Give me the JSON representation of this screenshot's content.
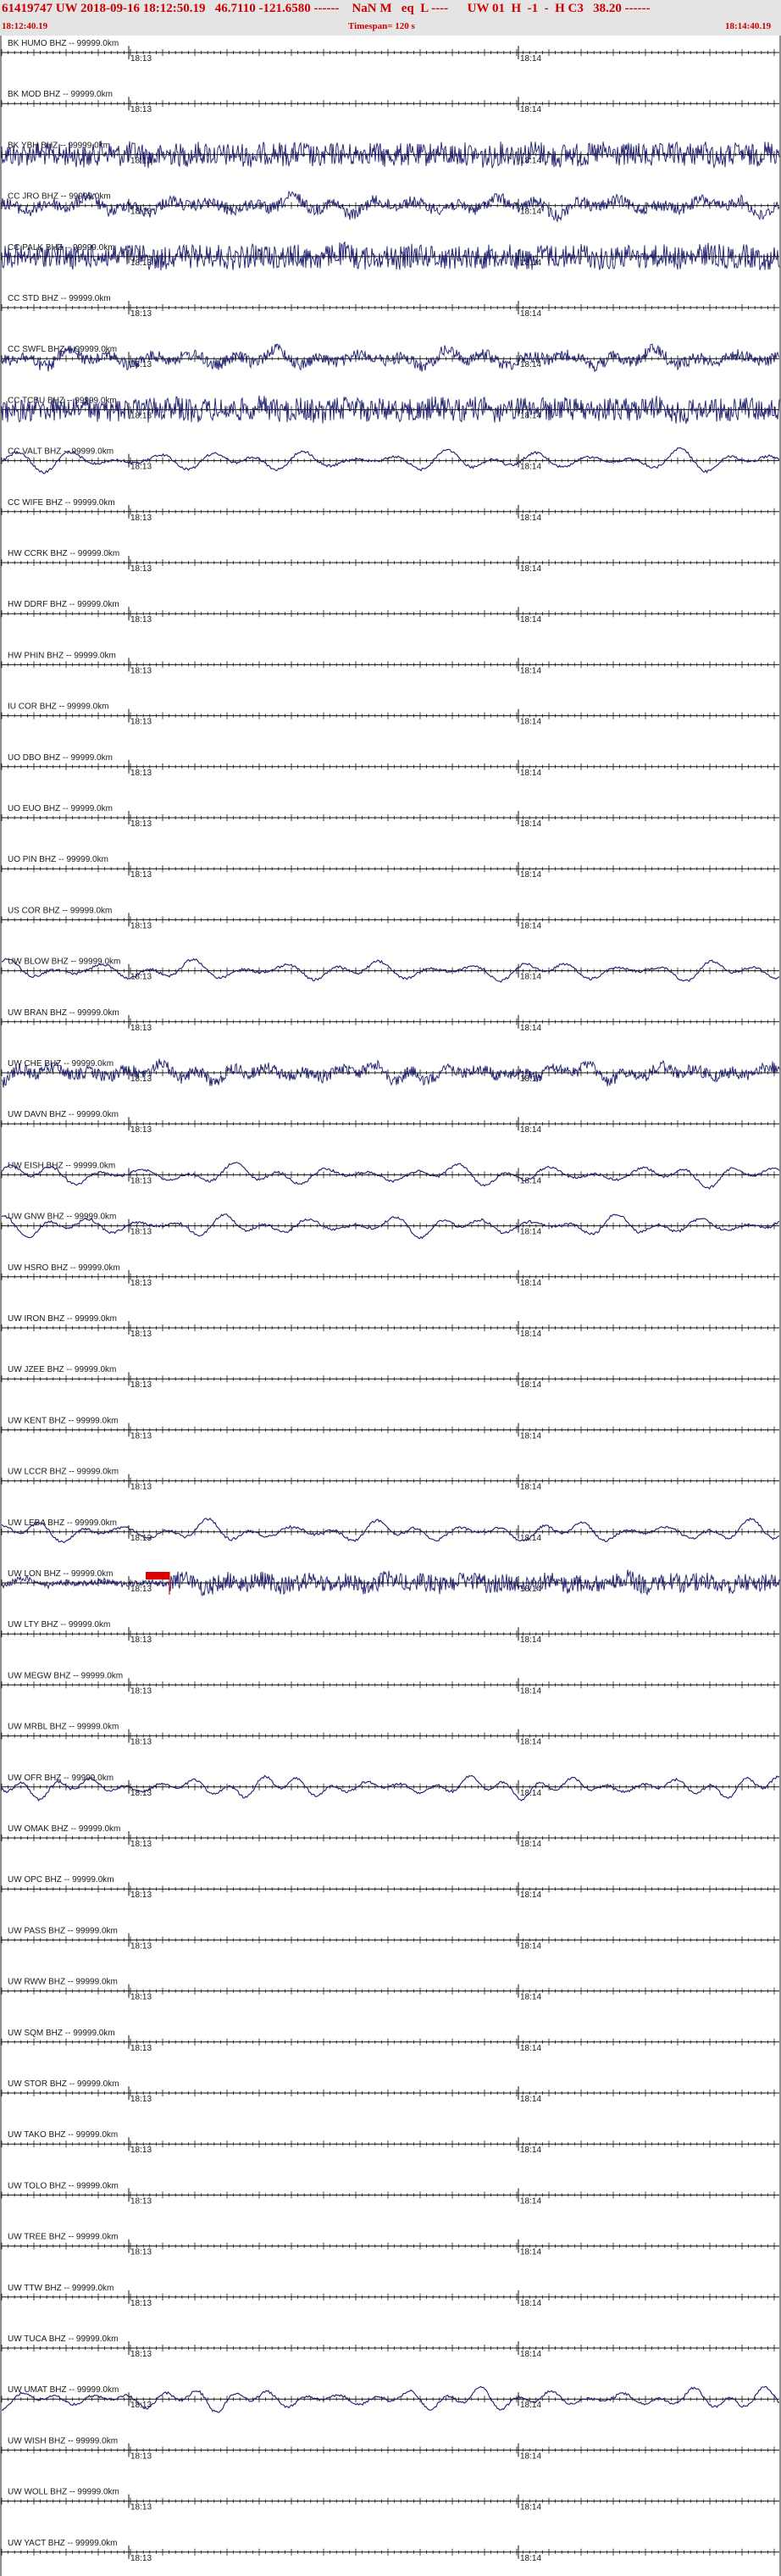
{
  "header": {
    "title": "61419747 UW 2018-09-16 18:12:50.19   46.7110 -121.6580 ------    NaN M   eq  L ----      UW 01  H  -1  -  H C3   38.20 ------",
    "start_time": "18:12:40.19",
    "timespan": "Timespan= 120 s",
    "end_time": "18:14:40.19"
  },
  "colors": {
    "trace": "#1b1b6b",
    "header_text": "#cc0000",
    "pick": "#dd0000"
  },
  "time_labels": [
    "18:13",
    "18:14"
  ],
  "stations": [
    {
      "label": "BK HUMO BHZ -- 99999.0km",
      "kind": "flat"
    },
    {
      "label": "BK MOD BHZ -- 99999.0km",
      "kind": "flat"
    },
    {
      "label": "BK YBH BHZ -- 99999.0km",
      "kind": "hf"
    },
    {
      "label": "CC JRO BHZ -- 99999.0km",
      "kind": "mix"
    },
    {
      "label": "CC PALK BHZ -- 99999.0km",
      "kind": "hf"
    },
    {
      "label": "CC STD BHZ -- 99999.0km",
      "kind": "flat"
    },
    {
      "label": "CC SWFL BHZ -- 99999.0km",
      "kind": "mix"
    },
    {
      "label": "CC TCBU BHZ -- 99999.0km",
      "kind": "hf"
    },
    {
      "label": "CC VALT BHZ -- 99999.0km",
      "kind": "lf"
    },
    {
      "label": "CC WIFE BHZ -- 99999.0km",
      "kind": "flat"
    },
    {
      "label": "HW CCRK BHZ -- 99999.0km",
      "kind": "flat"
    },
    {
      "label": "HW DDRF BHZ -- 99999.0km",
      "kind": "flat"
    },
    {
      "label": "HW PHIN BHZ -- 99999.0km",
      "kind": "flat"
    },
    {
      "label": "IU COR BHZ -- 99999.0km",
      "kind": "flat"
    },
    {
      "label": "UO DBO BHZ -- 99999.0km",
      "kind": "flat"
    },
    {
      "label": "UO EUO BHZ -- 99999.0km",
      "kind": "flat"
    },
    {
      "label": "UO PIN BHZ -- 99999.0km",
      "kind": "flat"
    },
    {
      "label": "US COR BHZ -- 99999.0km",
      "kind": "flat"
    },
    {
      "label": "UW BLOW BHZ -- 99999.0km",
      "kind": "lf"
    },
    {
      "label": "UW BRAN BHZ -- 99999.0km",
      "kind": "flat"
    },
    {
      "label": "UW CHE BHZ -- 99999.0km",
      "kind": "mix"
    },
    {
      "label": "UW DAVN BHZ -- 99999.0km",
      "kind": "flat"
    },
    {
      "label": "UW EISH BHZ -- 99999.0km",
      "kind": "lf"
    },
    {
      "label": "UW GNW BHZ -- 99999.0km",
      "kind": "lf"
    },
    {
      "label": "UW HSRO BHZ -- 99999.0km",
      "kind": "flat"
    },
    {
      "label": "UW IRON BHZ -- 99999.0km",
      "kind": "flat"
    },
    {
      "label": "UW JZEE BHZ -- 99999.0km",
      "kind": "flat"
    },
    {
      "label": "UW KENT BHZ -- 99999.0km",
      "kind": "flat"
    },
    {
      "label": "UW LCCR BHZ -- 99999.0km",
      "kind": "flat"
    },
    {
      "label": "UW LEBA BHZ -- 99999.0km",
      "kind": "lf"
    },
    {
      "label": "UW LON BHZ -- 99999.0km",
      "kind": "pick"
    },
    {
      "label": "UW LTY BHZ -- 99999.0km",
      "kind": "flat"
    },
    {
      "label": "UW MEGW BHZ -- 99999.0km",
      "kind": "flat"
    },
    {
      "label": "UW MRBL BHZ -- 99999.0km",
      "kind": "flat"
    },
    {
      "label": "UW OFR BHZ -- 99999.0km",
      "kind": "lf"
    },
    {
      "label": "UW OMAK BHZ -- 99999.0km",
      "kind": "flat"
    },
    {
      "label": "UW OPC BHZ -- 99999.0km",
      "kind": "flat"
    },
    {
      "label": "UW PASS BHZ -- 99999.0km",
      "kind": "flat"
    },
    {
      "label": "UW RWW BHZ -- 99999.0km",
      "kind": "flat"
    },
    {
      "label": "UW SQM BHZ -- 99999.0km",
      "kind": "flat"
    },
    {
      "label": "UW STOR BHZ -- 99999.0km",
      "kind": "flat"
    },
    {
      "label": "UW TAKO BHZ -- 99999.0km",
      "kind": "flat"
    },
    {
      "label": "UW TOLO BHZ -- 99999.0km",
      "kind": "flat"
    },
    {
      "label": "UW TREE BHZ -- 99999.0km",
      "kind": "flat"
    },
    {
      "label": "UW TTW BHZ -- 99999.0km",
      "kind": "flat"
    },
    {
      "label": "UW TUCA BHZ -- 99999.0km",
      "kind": "flat"
    },
    {
      "label": "UW UMAT BHZ -- 99999.0km",
      "kind": "lf"
    },
    {
      "label": "UW WISH BHZ -- 99999.0km",
      "kind": "flat"
    },
    {
      "label": "UW WOLL BHZ -- 99999.0km",
      "kind": "flat"
    },
    {
      "label": "UW YACT BHZ -- 99999.0km",
      "kind": "flat"
    }
  ]
}
